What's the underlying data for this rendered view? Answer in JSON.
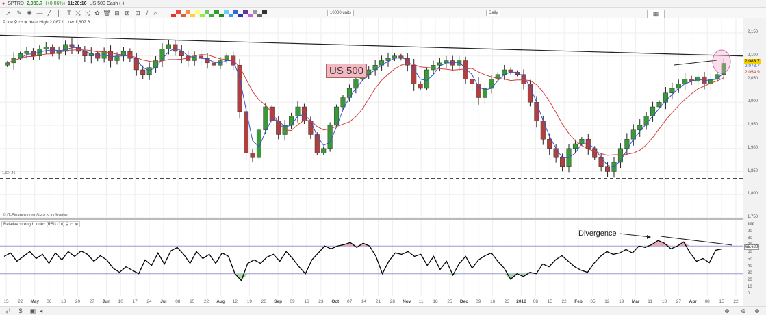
{
  "header": {
    "symbol": "SPTRD",
    "price": "2,083.7",
    "change": "(+0.06%)",
    "time": "11:20:16",
    "name": "US 500 Cash (-)"
  },
  "toolbar": {
    "units": "10000 units",
    "interval": "Daily"
  },
  "price_panel": {
    "label": "Price",
    "stats": "Year High 2,087.9 Low 1,807.6",
    "annotation": "US 500",
    "support_label": "1,834.45",
    "credit": "© IT-Finance.com",
    "credit_note": "Data is indicative",
    "tags": [
      {
        "text": "2,083.7",
        "color": "#f5d000"
      },
      {
        "text": "2,073.7",
        "color": "#3355cc"
      },
      {
        "text": "2,054.9",
        "color": "#cc3333"
      }
    ]
  },
  "rsi_panel": {
    "label": "Relative strength index (RSI) (10)",
    "annotation": "Divergence",
    "value_tag": "65.629"
  },
  "colors": {
    "up": "#3a9a3a",
    "down": "#b04040",
    "ma_fast": "#3355cc",
    "ma_slow": "#d04040",
    "rsi": "#000000",
    "band": "#9a9ad0"
  },
  "chart_data": [
    {
      "type": "candlestick",
      "title": "US 500 (SPTRD) Daily",
      "ylim": [
        1750,
        2150
      ],
      "yticks": [
        "2,150",
        "2,100",
        "2,050",
        "2,000",
        "1,950",
        "1,900",
        "1,850",
        "1,800",
        "1,750"
      ],
      "closes": [
        2085,
        2095,
        2105,
        2110,
        2100,
        2115,
        2120,
        2105,
        2110,
        2125,
        2120,
        2110,
        2100,
        2105,
        2095,
        2110,
        2090,
        2100,
        2110,
        2095,
        2070,
        2060,
        2075,
        2090,
        2115,
        2125,
        2110,
        2100,
        2090,
        2100,
        2095,
        2085,
        2080,
        2090,
        2100,
        2080,
        1980,
        1890,
        1880,
        1940,
        1990,
        1960,
        1930,
        1950,
        1970,
        1990,
        1960,
        1930,
        1890,
        1900,
        1950,
        1990,
        2010,
        2030,
        2050,
        2060,
        2070,
        2080,
        2090,
        2095,
        2100,
        2095,
        2080,
        2040,
        2030,
        2070,
        2080,
        2085,
        2090,
        2080,
        2090,
        2050,
        2040,
        2010,
        2030,
        2050,
        2060,
        2070,
        2065,
        2060,
        2040,
        2000,
        1960,
        1920,
        1900,
        1880,
        1860,
        1900,
        1910,
        1920,
        1900,
        1880,
        1860,
        1850,
        1870,
        1900,
        1920,
        1940,
        1950,
        1970,
        1990,
        2000,
        2020,
        2030,
        2040,
        2050,
        2045,
        2055,
        2040,
        2050,
        2060,
        2084
      ],
      "resistance": [
        2145,
        2100
      ],
      "support": 1834.45
    },
    {
      "type": "line",
      "title": "RSI (10)",
      "ylim": [
        0,
        100
      ],
      "bands": [
        30,
        70
      ],
      "yticks": [
        "100",
        "90",
        "80",
        "70",
        "60",
        "50",
        "40",
        "30",
        "20",
        "10",
        "0"
      ],
      "values": [
        55,
        60,
        48,
        55,
        62,
        52,
        58,
        45,
        60,
        50,
        62,
        55,
        63,
        58,
        48,
        56,
        50,
        38,
        32,
        40,
        35,
        30,
        50,
        42,
        60,
        44,
        63,
        68,
        58,
        45,
        62,
        52,
        58,
        45,
        60,
        55,
        30,
        20,
        45,
        50,
        45,
        54,
        58,
        48,
        62,
        52,
        40,
        30,
        50,
        60,
        70,
        66,
        70,
        72,
        75,
        68,
        74,
        70,
        55,
        30,
        48,
        60,
        58,
        62,
        55,
        58,
        42,
        55,
        36,
        48,
        28,
        45,
        55,
        38,
        50,
        56,
        60,
        48,
        38,
        22,
        30,
        26,
        32,
        30,
        44,
        40,
        50,
        56,
        48,
        40,
        35,
        32,
        45,
        55,
        62,
        58,
        60,
        65,
        60,
        70,
        68,
        72,
        78,
        74,
        66,
        70,
        76,
        60,
        48,
        52,
        46,
        64,
        66
      ],
      "xticks": [
        "15",
        "22",
        "May",
        "06",
        "13",
        "20",
        "27",
        "Jun",
        "10",
        "17",
        "24",
        "Jul",
        "08",
        "15",
        "22",
        "Aug",
        "12",
        "19",
        "26",
        "Sep",
        "09",
        "16",
        "23",
        "Oct",
        "07",
        "14",
        "21",
        "28",
        "Nov",
        "11",
        "18",
        "25",
        "Dec",
        "09",
        "16",
        "23",
        "2016",
        "08",
        "15",
        "22",
        "Feb",
        "05",
        "12",
        "19",
        "Mar",
        "11",
        "18",
        "27",
        "Apr",
        "08",
        "15",
        "22"
      ]
    }
  ]
}
